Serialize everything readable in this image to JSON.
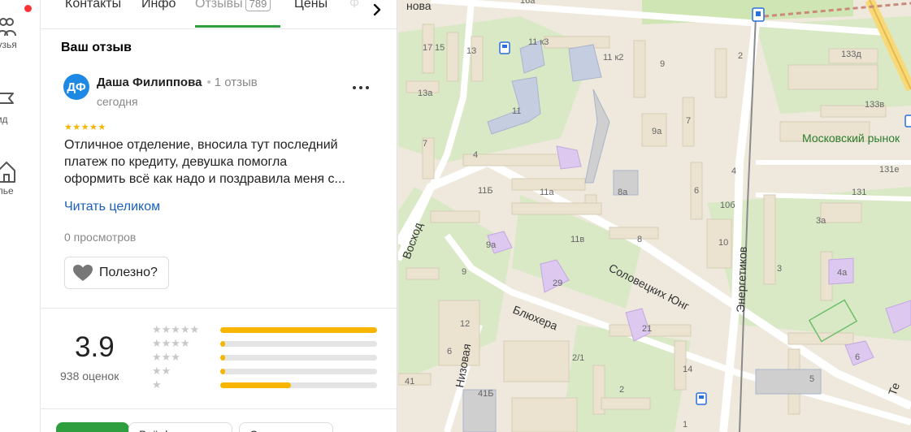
{
  "rail": {
    "items": [
      {
        "label": "рузья",
        "icon": "friends-icon"
      },
      {
        "label": "Гид",
        "icon": "guide-flag-icon"
      },
      {
        "label": "илье",
        "icon": "housing-icon"
      }
    ],
    "notification_color": "#ff3333"
  },
  "tabs": [
    {
      "label": "Контакты"
    },
    {
      "label": "Инфо"
    },
    {
      "label": "Отзывы",
      "count": "789",
      "active": true
    },
    {
      "label": "Цены"
    },
    {
      "label": "Ф"
    }
  ],
  "review": {
    "heading": "Ваш отзыв",
    "avatar_initials": "ДФ",
    "author": "Даша Филиппова",
    "author_reviews": "1 отзыв",
    "date": "сегодня",
    "stars": 5,
    "text_lines": [
      "Отличное отделение, вносила тут последний",
      "платеж по кредиту, девушка помогла",
      "оформить всё как надо и поздравила меня с..."
    ],
    "read_more": "Читать целиком",
    "views": "0 просмотров",
    "useful_label": "Полезно?"
  },
  "rating": {
    "value": "3.9",
    "count": "938 оценок",
    "distribution": [
      {
        "stars": 5,
        "fraction": 1.0
      },
      {
        "stars": 4,
        "fraction": 0.03
      },
      {
        "stars": 3,
        "fraction": 0.03
      },
      {
        "stars": 2,
        "fraction": 0.03
      },
      {
        "stars": 1,
        "fraction": 0.45
      }
    ]
  },
  "bottom_pills": [
    {
      "label": "",
      "style": "green"
    },
    {
      "label": "Всё фото",
      "style": "outline"
    },
    {
      "label": "С ответом",
      "style": "outline"
    }
  ],
  "map": {
    "street_labels": [
      "Восход",
      "Соловецких Юнг",
      "Блюхера",
      "Низовая",
      "Энергетиков",
      "нова",
      "Те"
    ],
    "poi_label": "Московский рынок",
    "house_numbers": [
      "17",
      "15",
      "13",
      "13а",
      "11 к3",
      "11 к2",
      "9",
      "2",
      "133д",
      "11",
      "9а",
      "7",
      "133в",
      "7",
      "4",
      "4",
      "11Б",
      "11а",
      "8а",
      "6",
      "10б",
      "131е",
      "131",
      "9а",
      "11в",
      "8",
      "10",
      "3а",
      "9",
      "29",
      "3",
      "4а",
      "21",
      "12",
      "6",
      "2/1",
      "14",
      "6",
      "41",
      "41Б",
      "2",
      "5",
      "1",
      "16а"
    ],
    "colors": {
      "park": "#d6e8c0",
      "road": "#ffffff",
      "building": "#ebe3cf",
      "poi_building": "#d9c9f0",
      "rail": "#8a8a8a",
      "major_road": "#f7d97a",
      "label_green": "#2a7d2e"
    }
  }
}
